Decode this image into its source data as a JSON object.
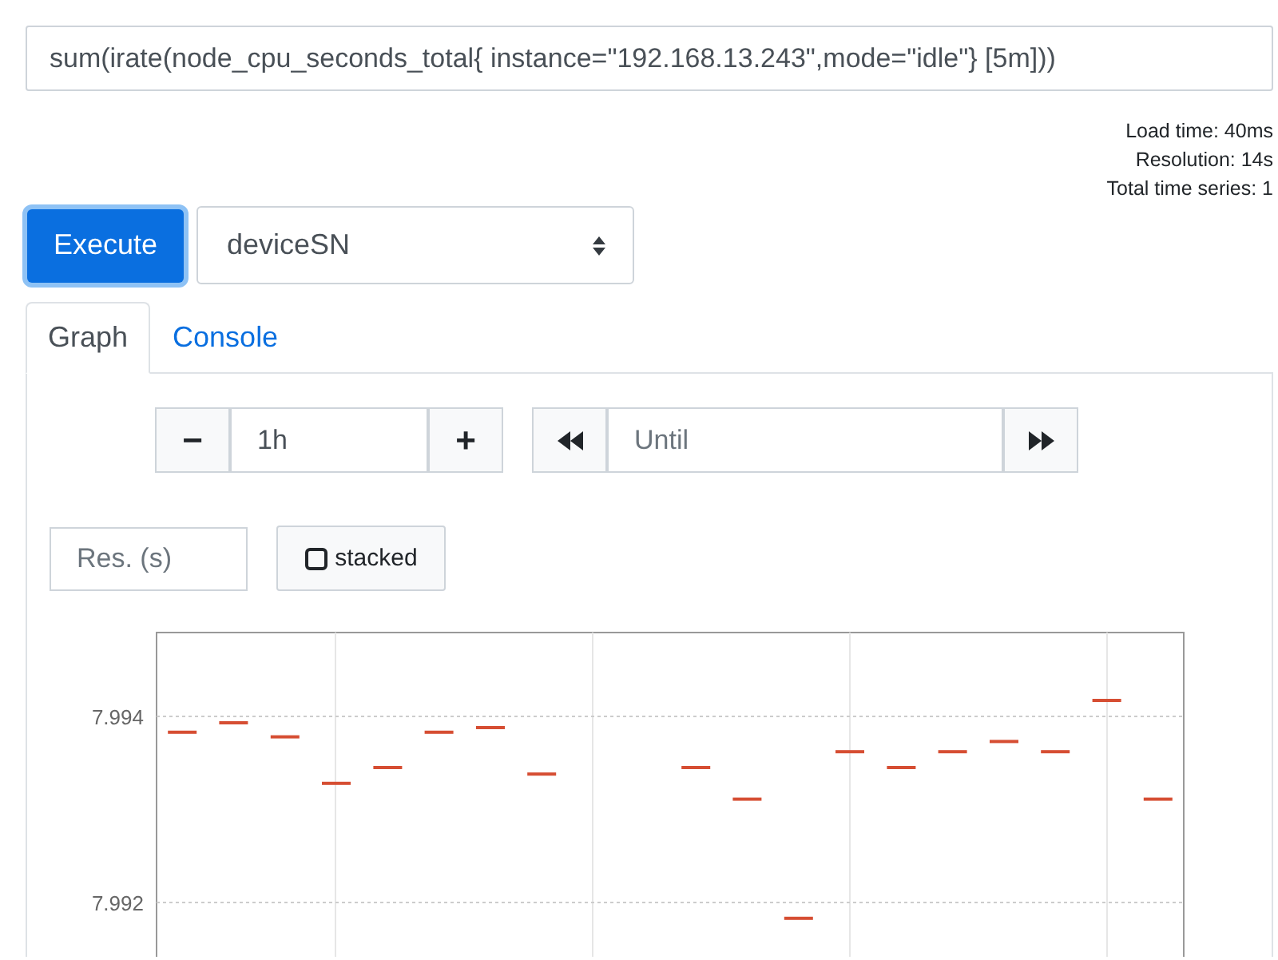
{
  "query": {
    "value": "sum(irate(node_cpu_seconds_total{ instance=\"192.168.13.243\",mode=\"idle\"} [5m]))"
  },
  "stats": [
    "Load time: 40ms",
    "Resolution: 14s",
    "Total time series: 1"
  ],
  "execute_button": "Execute",
  "metric_select": {
    "value": "deviceSN"
  },
  "tabs": [
    {
      "label": "Graph",
      "selected": true
    },
    {
      "label": "Console",
      "selected": false
    }
  ],
  "range": {
    "decrease": "−",
    "value": "1h",
    "increase": "+"
  },
  "end_time": {
    "placeholder": "Until"
  },
  "resolution": {
    "placeholder": "Res. (s)"
  },
  "stacked": {
    "label": "stacked",
    "checked": false
  },
  "graph": {
    "y_axis_labels": [
      "7.994",
      "7.992"
    ]
  }
}
